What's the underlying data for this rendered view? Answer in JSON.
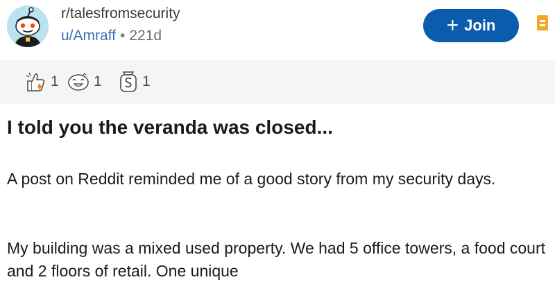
{
  "header": {
    "subreddit": "r/talesfromsecurity",
    "username": "u/Amraff",
    "separator": "•",
    "age": "221d",
    "join_label": "Join",
    "join_plus": "+"
  },
  "awards": [
    {
      "icon": "thumbs-up-award-icon",
      "count": "1"
    },
    {
      "icon": "laughing-face-award-icon",
      "count": "1"
    },
    {
      "icon": "silver-award-icon",
      "count": "1"
    }
  ],
  "post": {
    "title": "I told you the veranda was closed...",
    "paragraphs": [
      "A post on Reddit reminded me of a good story from my security days.",
      "My building was a mixed used property. We had 5 office towers, a food court and 2 floors of retail. One unique"
    ]
  },
  "colors": {
    "join_button": "#0b5cad",
    "username": "#3b6fb6",
    "awards_bar": "#f5f5f5",
    "save_icon": "#f5a623"
  }
}
